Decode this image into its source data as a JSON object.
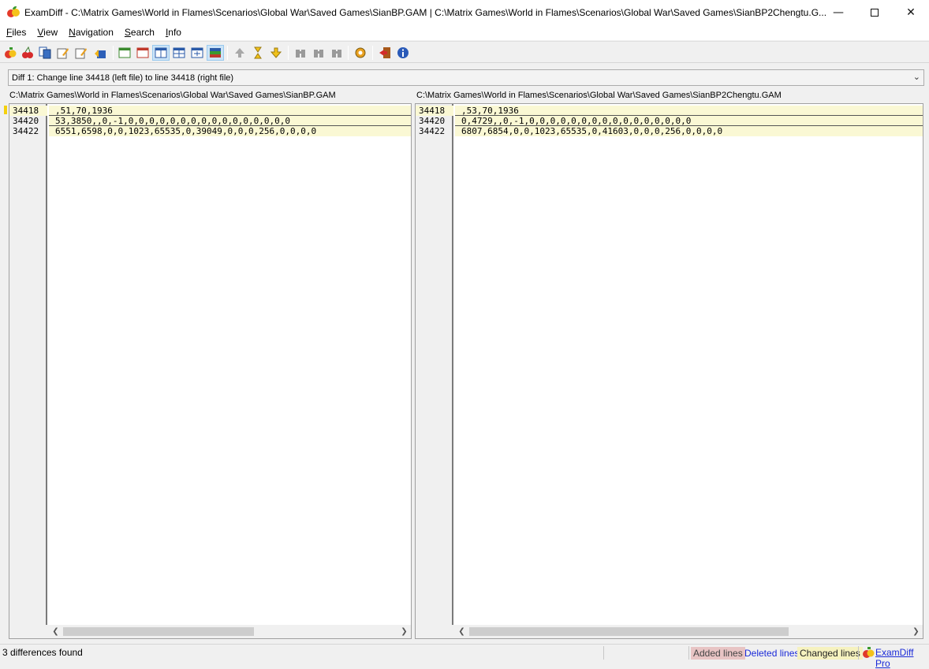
{
  "window": {
    "title": "ExamDiff - C:\\Matrix Games\\World in Flames\\Scenarios\\Global War\\Saved Games\\SianBP.GAM  |  C:\\Matrix Games\\World in Flames\\Scenarios\\Global War\\Saved Games\\SianBP2Chengtu.G...",
    "min_glyph": "—",
    "close_glyph": "✕"
  },
  "menu": {
    "items": [
      {
        "u": "F",
        "rest": "iles"
      },
      {
        "u": "V",
        "rest": "iew"
      },
      {
        "u": "N",
        "rest": "avigation"
      },
      {
        "u": "S",
        "rest": "earch"
      },
      {
        "u": "I",
        "rest": "nfo"
      }
    ]
  },
  "diff_selector": {
    "value": "Diff 1: Change line 34418 (left file) to line 34418 (right file)"
  },
  "left": {
    "path": "C:\\Matrix Games\\World in Flames\\Scenarios\\Global War\\Saved Games\\SianBP.GAM",
    "lines": [
      {
        "num": "34418",
        "text": ",51,70,1936"
      },
      {
        "num": "34420",
        "text": "53,3850,,0,-1,0,0,0,0,0,0,0,0,0,0,0,0,0,0,0,0"
      },
      {
        "num": "34422",
        "text": "6551,6598,0,0,1023,65535,0,39049,0,0,0,256,0,0,0,0"
      }
    ]
  },
  "right": {
    "path": "C:\\Matrix Games\\World in Flames\\Scenarios\\Global War\\Saved Games\\SianBP2Chengtu.GAM",
    "lines": [
      {
        "num": "34418",
        "text": ",53,70,1936"
      },
      {
        "num": "34420",
        "text": "0,4729,,0,-1,0,0,0,0,0,0,0,0,0,0,0,0,0,0,0,0"
      },
      {
        "num": "34422",
        "text": "6807,6854,0,0,1023,65535,0,41603,0,0,0,256,0,0,0,0"
      }
    ]
  },
  "status": {
    "message": "3 differences found",
    "added": "Added lines",
    "deleted": "Deleted lines",
    "changed": "Changed lines",
    "pro_link": "ExamDiff Pro"
  },
  "colors": {
    "changed_bg": "#faf8d4",
    "added_bg": "#e8c4c4",
    "deleted_fg": "#1a2ad8",
    "marker": "#f4d00c"
  },
  "icons": {
    "toolbar": [
      "compare-icon",
      "recompare-icon",
      "swap-files-icon",
      "edit-left-icon",
      "edit-right-icon",
      "save-icon",
      "view-left-icon",
      "view-right-icon",
      "split-vertical-icon",
      "split-horizontal-icon",
      "split-cross-icon",
      "color-bars-icon",
      "prev-diff-icon",
      "current-diff-icon",
      "next-diff-icon",
      "find-icon",
      "find-prev-icon",
      "find-next-icon",
      "options-icon",
      "exit-icon",
      "about-icon"
    ]
  }
}
